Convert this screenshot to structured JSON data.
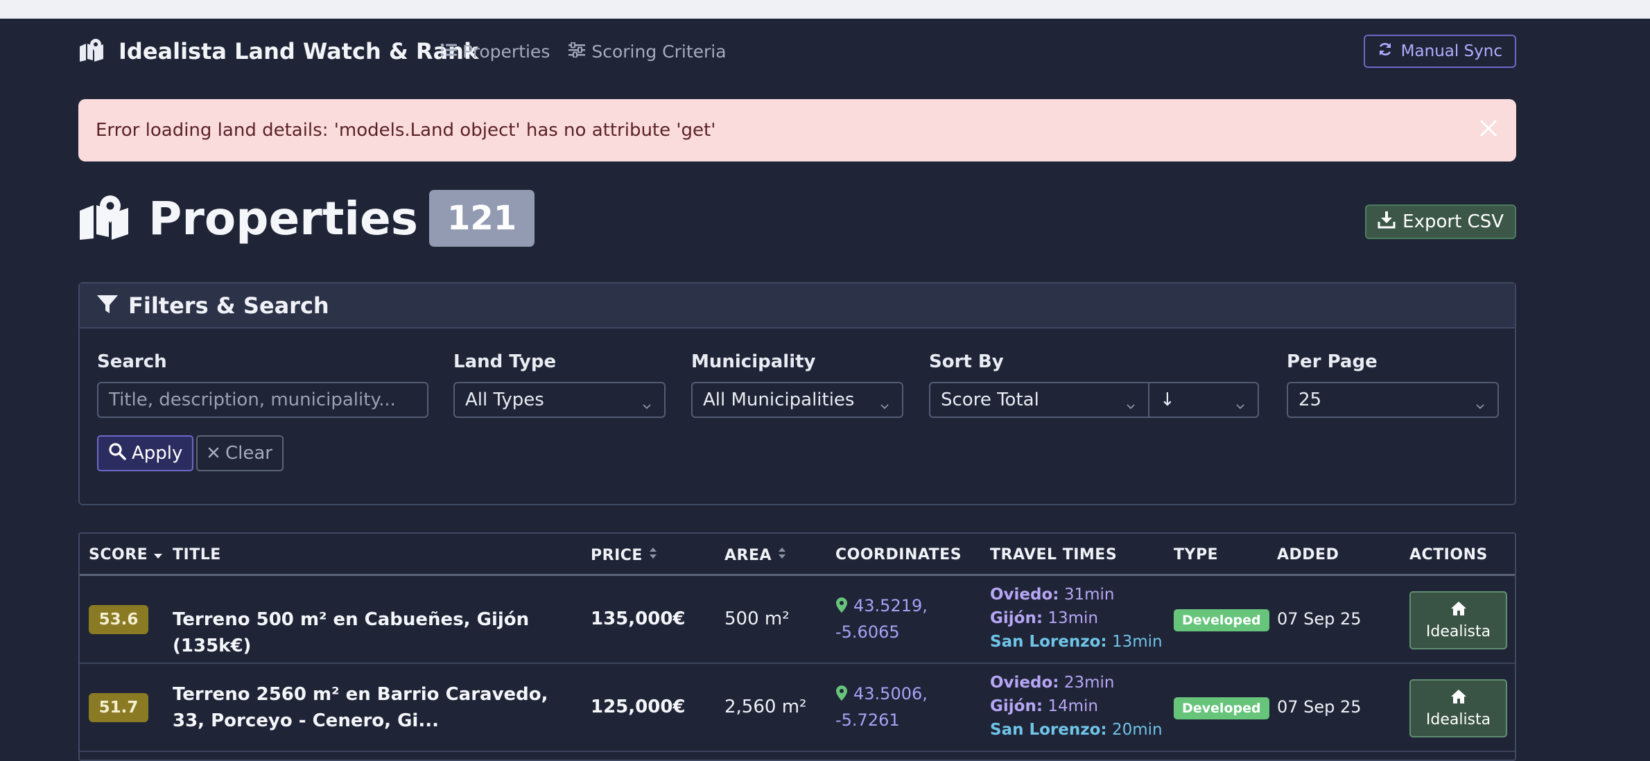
{
  "navbar": {
    "brand": "Idealista Land Watch & Rank",
    "links": [
      {
        "label": "Properties",
        "icon": "list-icon"
      },
      {
        "label": "Scoring Criteria",
        "icon": "sliders-icon"
      }
    ],
    "sync_label": "Manual Sync"
  },
  "alert": {
    "message": "Error loading land details: 'models.Land object' has no attribute 'get'"
  },
  "page": {
    "title": "Properties",
    "count": "121",
    "export_label": "Export CSV"
  },
  "filters": {
    "title": "Filters & Search",
    "search_label": "Search",
    "search_placeholder": "Title, description, municipality...",
    "land_type_label": "Land Type",
    "land_type_value": "All Types",
    "municipality_label": "Municipality",
    "municipality_value": "All Municipalities",
    "sort_label": "Sort By",
    "sort_value": "Score Total",
    "sort_dir_value": "↓",
    "per_page_label": "Per Page",
    "per_page_value": "25",
    "apply_label": "Apply",
    "clear_label": "Clear"
  },
  "table": {
    "headers": {
      "score": "SCORE",
      "title": "TITLE",
      "price": "PRICE",
      "area": "AREA",
      "coordinates": "COORDINATES",
      "travel": "TRAVEL TIMES",
      "type": "TYPE",
      "added": "ADDED",
      "actions": "ACTIONS"
    },
    "rows": [
      {
        "score": "53.6",
        "title": "Terreno 500 m² en Cabueñes, Gijón (135k€)",
        "price": "135,000€",
        "area": "500 m²",
        "coords": "43.5219, -5.6065",
        "oviedo_label": "Oviedo:",
        "oviedo_value": "31min",
        "gijon_label": "Gijón:",
        "gijon_value": "13min",
        "sanlorenzo_label": "San Lorenzo:",
        "sanlorenzo_value": "13min",
        "type": "Developed",
        "added": "07 Sep 25",
        "action": "Idealista"
      },
      {
        "score": "51.7",
        "title": "Terreno 2560 m² en Barrio Caravedo, 33, Porceyo - Cenero, Gi...",
        "price": "125,000€",
        "area": "2,560 m²",
        "coords": "43.5006, -5.7261",
        "oviedo_label": "Oviedo:",
        "oviedo_value": "23min",
        "gijon_label": "Gijón:",
        "gijon_value": "14min",
        "sanlorenzo_label": "San Lorenzo:",
        "sanlorenzo_value": "20min",
        "type": "Developed",
        "added": "07 Sep 25",
        "action": "Idealista"
      }
    ]
  },
  "colors": {
    "background": "#1f2436",
    "accent": "#6e69c8",
    "score_badge": "#8a7a24",
    "type_badge": "#67c47b",
    "alert_bg": "#fadcdd"
  }
}
